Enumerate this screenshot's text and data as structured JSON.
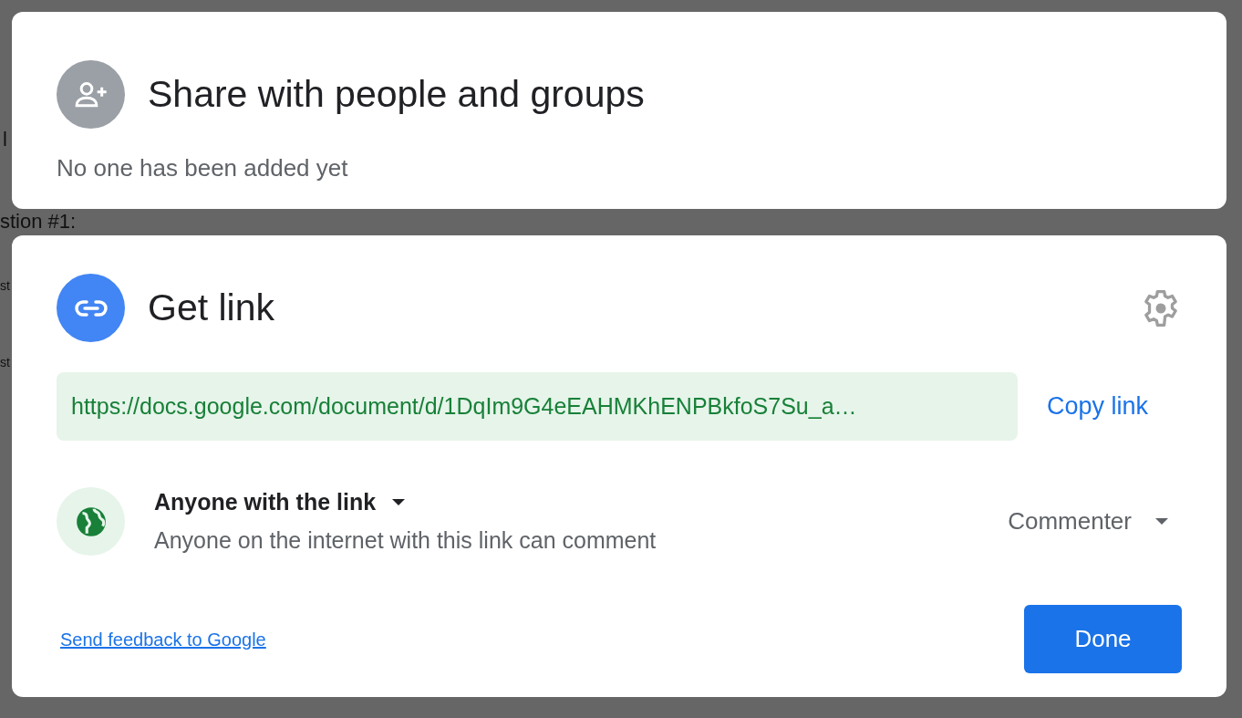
{
  "background_document": {
    "lines": [
      "l",
      "stion #1:",
      "st",
      "st"
    ]
  },
  "share_panel": {
    "title": "Share with people and groups",
    "status": "No one has been added yet"
  },
  "link_panel": {
    "title": "Get link",
    "url": "https://docs.google.com/document/d/1DqIm9G4eEAHMKhENPBkfoS7Su_a…",
    "copy_label": "Copy link",
    "access": {
      "scope": "Anyone with the link",
      "description": "Anyone on the internet with this link can comment",
      "role": "Commenter"
    },
    "feedback_link": "Send feedback to Google",
    "done_label": "Done"
  }
}
